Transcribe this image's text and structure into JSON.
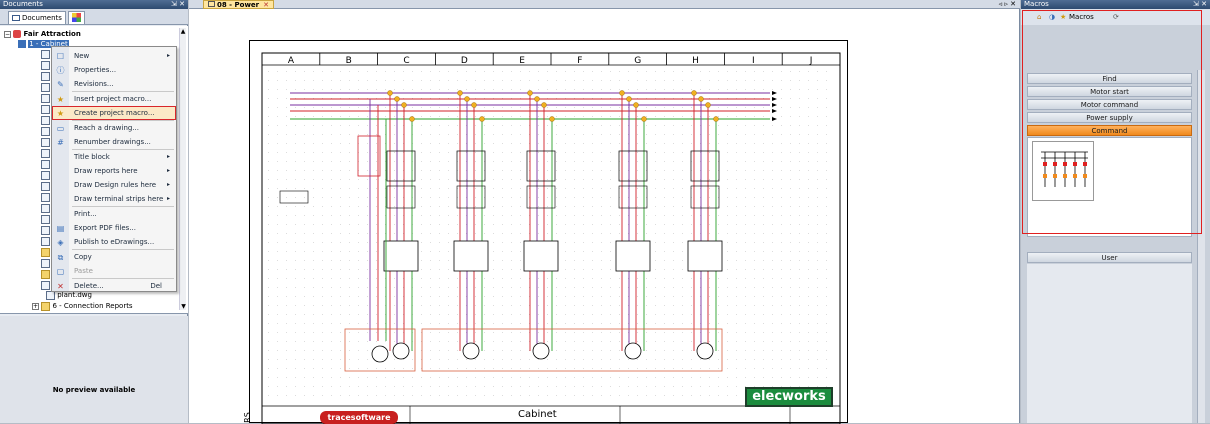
{
  "left_panel": {
    "title": "Documents",
    "controls": "⇲ ✕",
    "tabs": [
      {
        "label": "Documents"
      },
      {
        "label": ""
      }
    ],
    "tree": {
      "root": "Fair Attraction",
      "selected": "1 - Cabinet",
      "items_after_menu": [
        "plant.dwg",
        "6 - Connection Reports"
      ]
    },
    "preview_label": "No preview available"
  },
  "context_menu": {
    "items": [
      {
        "label": "New",
        "arrow": "▸",
        "icon": "new-icon",
        "glyph": "☐"
      },
      {
        "label": "Properties...",
        "icon": "info-icon",
        "glyph": "ⓘ"
      },
      {
        "label": "Revisions...",
        "icon": "revisions-icon",
        "glyph": "✎"
      },
      {
        "label": "Insert project macro...",
        "icon": "star-icon",
        "glyph": "★"
      },
      {
        "label": "Create project macro...",
        "icon": "macro-create-icon",
        "glyph": "★",
        "highlight": true
      },
      {
        "label": "Reach a drawing...",
        "icon": "folder-open-icon",
        "glyph": "▭"
      },
      {
        "label": "Renumber drawings...",
        "icon": "renumber-icon",
        "glyph": "#"
      },
      {
        "label": "Title block",
        "arrow": "▸",
        "icon": "",
        "glyph": ""
      },
      {
        "label": "Draw reports here",
        "arrow": "▸",
        "icon": "",
        "glyph": ""
      },
      {
        "label": "Draw Design rules here",
        "arrow": "▸",
        "icon": "",
        "glyph": ""
      },
      {
        "label": "Draw terminal strips here",
        "arrow": "▸",
        "icon": "",
        "glyph": ""
      },
      {
        "label": "Print...",
        "icon": "",
        "glyph": ""
      },
      {
        "label": "Export PDF files...",
        "icon": "pdf-icon",
        "glyph": "▤"
      },
      {
        "label": "Publish to eDrawings...",
        "icon": "edrawings-icon",
        "glyph": "◈"
      },
      {
        "label": "Copy",
        "icon": "copy-icon",
        "glyph": "⧉"
      },
      {
        "label": "Paste",
        "icon": "paste-icon",
        "glyph": "▢",
        "disabled": true
      },
      {
        "label": "Delete...",
        "shortcut": "Del",
        "icon": "delete-icon",
        "glyph": "✕"
      }
    ]
  },
  "document_tab": {
    "label": "08 - Power",
    "close": "✕",
    "nav": "◃ ▹ ✕"
  },
  "drawing": {
    "columns": [
      "A",
      "B",
      "C",
      "D",
      "E",
      "F",
      "G",
      "H",
      "I",
      "J"
    ],
    "title": "Cabinet",
    "logo_brand": "elecworks",
    "publisher": "tracesoftware",
    "left_mark": "RS"
  },
  "right_panel": {
    "title": "Macros",
    "controls": "⇲ ✕",
    "tab_label": "Macros",
    "buttons": [
      "Find",
      "Motor start",
      "Motor command",
      "Power supply",
      "Command",
      "User"
    ],
    "active_button": "Command"
  },
  "colors": {
    "accent": "#f08a1d",
    "highlight": "#e02020",
    "title_bar": "#2d4a70"
  }
}
